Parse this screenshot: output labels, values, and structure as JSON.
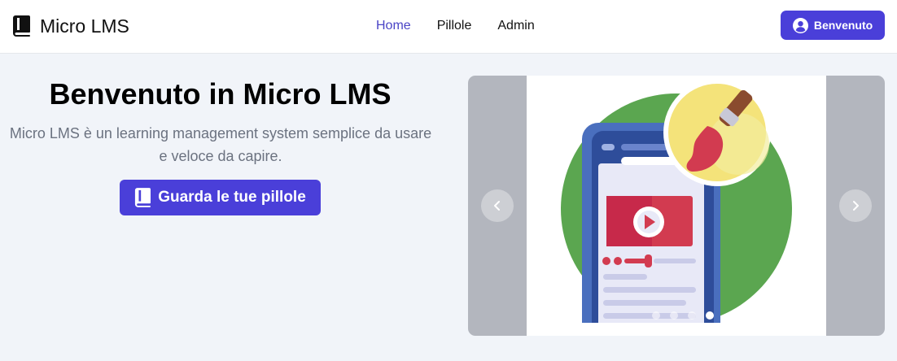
{
  "header": {
    "brand_title": "Micro LMS",
    "brand_icon": "book-icon",
    "nav": [
      {
        "label": "Home",
        "active": true
      },
      {
        "label": "Pillole",
        "active": false
      },
      {
        "label": "Admin",
        "active": false
      }
    ],
    "user_button_label": "Benvenuto",
    "user_icon": "user-circle-icon"
  },
  "hero": {
    "title": "Benvenuto in Micro LMS",
    "description": "Micro LMS è un learning management system semplice da usare e veloce da capire.",
    "cta_label": "Guarda le tue pillole",
    "cta_icon": "book-icon"
  },
  "carousel": {
    "slide_count": 4,
    "active_slide": 4,
    "prev_icon": "chevron-left-icon",
    "next_icon": "chevron-right-icon"
  },
  "colors": {
    "accent": "#4a3fd9",
    "nav_active": "#4a44c6",
    "page_bg": "#f1f4f9",
    "carousel_bg": "#b3b6be"
  }
}
